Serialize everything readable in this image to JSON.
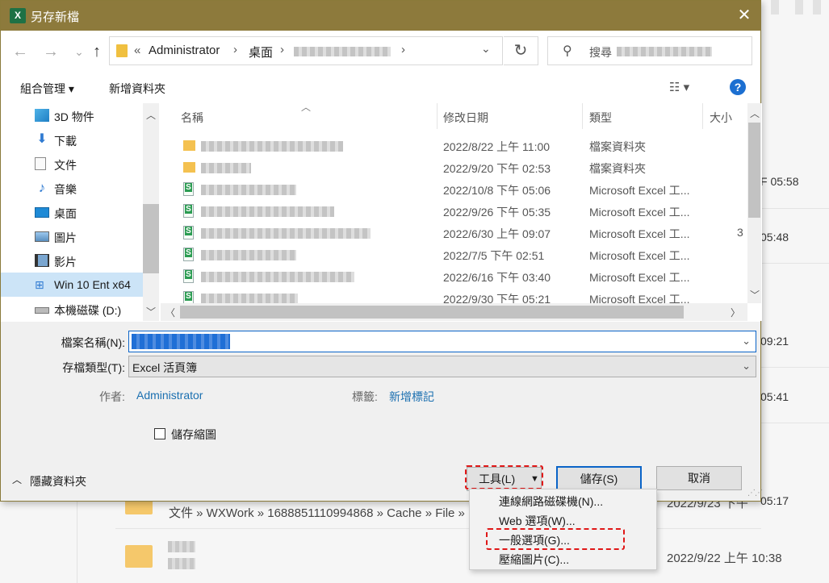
{
  "window": {
    "title": "另存新檔",
    "close_glyph": "✕",
    "app_icon": "X"
  },
  "nav": {
    "back_glyph": "←",
    "forward_glyph": "→",
    "recent_glyph": "⌄",
    "up_glyph": "↑"
  },
  "address": {
    "overflow": "«",
    "crumbs": [
      "Administrator",
      "桌面"
    ],
    "separator": "›",
    "dropdown_glyph": "⌄",
    "refresh_glyph": "↻"
  },
  "search": {
    "placeholder": "搜尋",
    "icon": "⚲"
  },
  "toolbar": {
    "organize": "組合管理 ▾",
    "new_folder": "新增資料夾",
    "view_icon": "☷ ▾",
    "help": "?"
  },
  "sidebar": {
    "items": [
      {
        "label": "3D 物件",
        "icon": "cube-icon"
      },
      {
        "label": "下載",
        "icon": "download-icon"
      },
      {
        "label": "文件",
        "icon": "document-icon"
      },
      {
        "label": "音樂",
        "icon": "music-icon"
      },
      {
        "label": "桌面",
        "icon": "desktop-icon"
      },
      {
        "label": "圖片",
        "icon": "pictures-icon"
      },
      {
        "label": "影片",
        "icon": "video-icon"
      },
      {
        "label": "Win 10 Ent x64",
        "icon": "windows-drive-icon"
      },
      {
        "label": "本機磁碟 (D:)",
        "icon": "drive-icon"
      }
    ]
  },
  "filelist": {
    "columns": {
      "name": "名稱",
      "modified": "修改日期",
      "type": "類型",
      "size": "大小"
    },
    "rows": [
      {
        "kind": "folder",
        "date": "2022/8/22 上午 11:00",
        "type": "檔案資料夾",
        "size": ""
      },
      {
        "kind": "folder",
        "date": "2022/9/20 下午 02:53",
        "type": "檔案資料夾",
        "size": ""
      },
      {
        "kind": "xls",
        "date": "2022/10/8 下午 05:06",
        "type": "Microsoft Excel 工...",
        "size": ""
      },
      {
        "kind": "xls",
        "date": "2022/9/26 下午 05:35",
        "type": "Microsoft Excel 工...",
        "size": ""
      },
      {
        "kind": "xls",
        "date": "2022/6/30 上午 09:07",
        "type": "Microsoft Excel 工...",
        "size": "3"
      },
      {
        "kind": "xls",
        "date": "2022/7/5 下午 02:51",
        "type": "Microsoft Excel 工...",
        "size": ""
      },
      {
        "kind": "xls",
        "date": "2022/6/16 下午 03:40",
        "type": "Microsoft Excel 工...",
        "size": ""
      },
      {
        "kind": "xls",
        "date": "2022/9/30 下午 05:21",
        "type": "Microsoft Excel 工...",
        "size": ""
      }
    ]
  },
  "form": {
    "filename_label": "檔案名稱(N):",
    "filetype_label": "存檔類型(T):",
    "filetype_value": "Excel 活頁簿",
    "author_label": "作者:",
    "author_value": "Administrator",
    "tags_label": "標籤:",
    "tags_value": "新增標記",
    "save_thumbnail": "儲存縮圖",
    "hide_folders": "隱藏資料夾",
    "dropdown_glyph": "⌄"
  },
  "buttons": {
    "tools": "工具(L)",
    "tools_caret": "▼",
    "save": "儲存(S)",
    "cancel": "取消"
  },
  "tools_menu": {
    "items": [
      "連線網路磁碟機(N)...",
      "Web 選項(W)...",
      "一般選項(G)...",
      "壓縮圖片(C)..."
    ]
  },
  "background": {
    "times": [
      "F 05:58",
      "05:48",
      "09:21",
      "05:41",
      "05:17"
    ],
    "path_text": "文件 » WXWork » 1688851110994868 » Cache » File »",
    "row_date_1": "2022/9/23 下午",
    "row_date_2": "2022/9/22 上午 10:38"
  }
}
